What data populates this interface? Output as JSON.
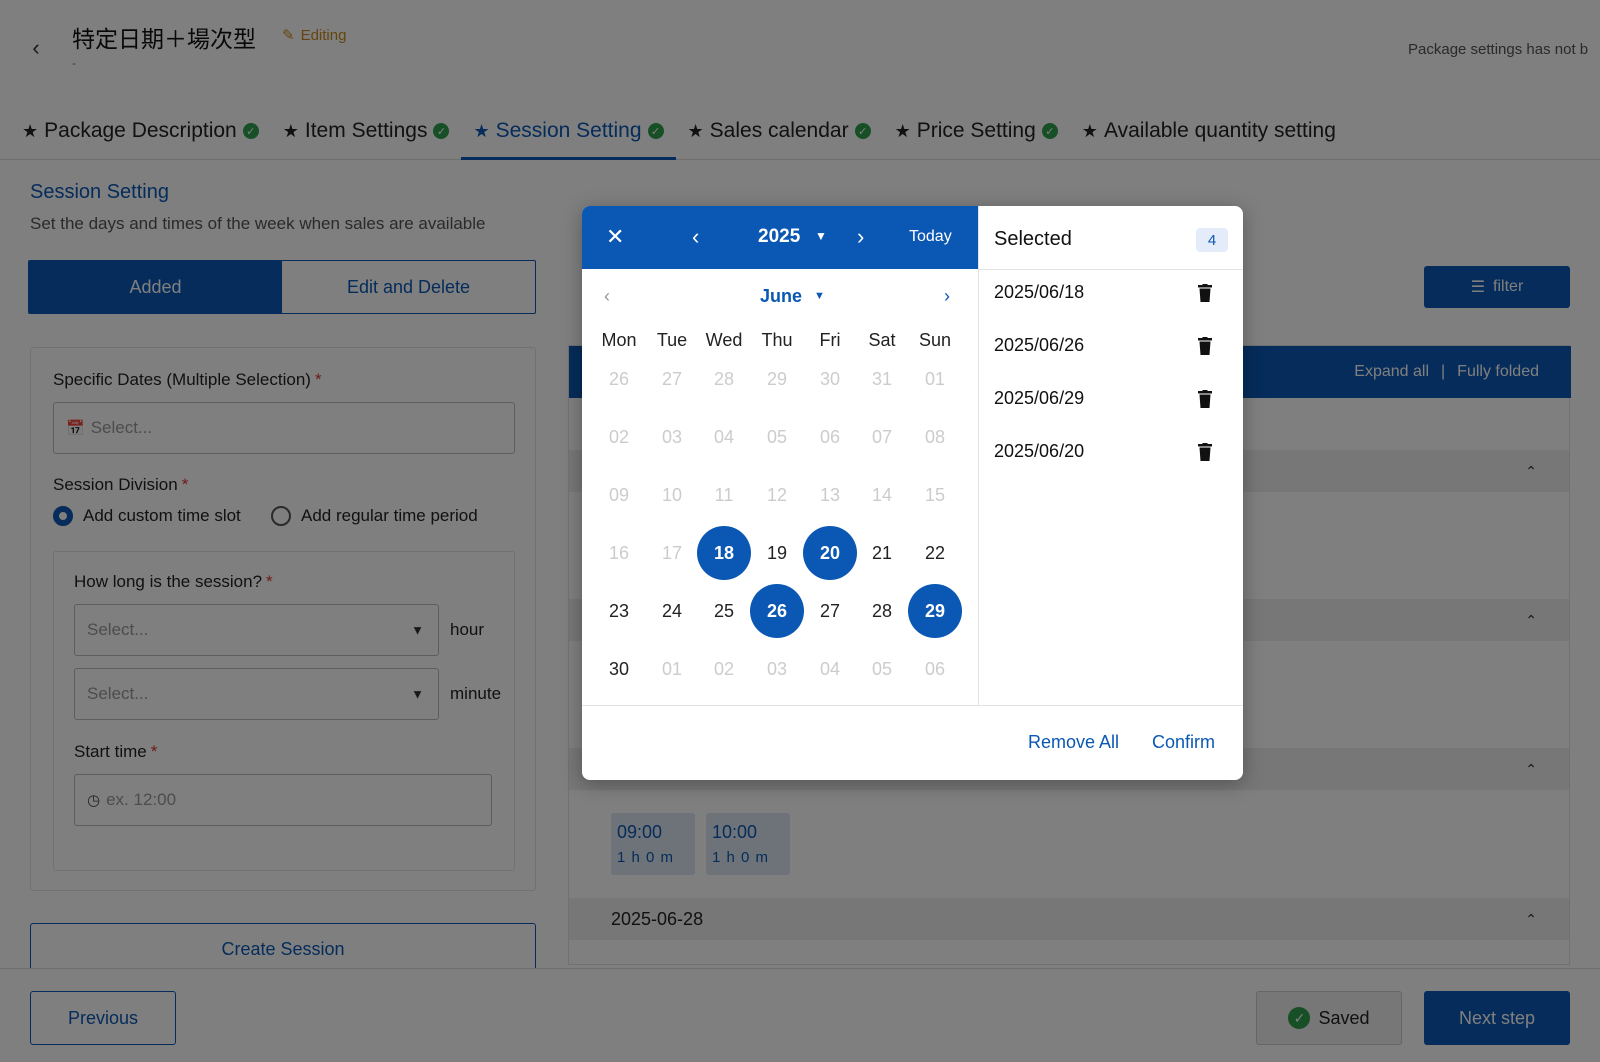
{
  "header": {
    "title": "特定日期＋場次型",
    "editing_label": "Editing",
    "sub_text": "-",
    "notice": "Package settings has not b"
  },
  "tabs": [
    {
      "label": "Package Description",
      "done": true
    },
    {
      "label": "Item Settings",
      "done": true
    },
    {
      "label": "Session Setting",
      "done": true,
      "active": true
    },
    {
      "label": "Sales calendar",
      "done": true
    },
    {
      "label": "Price Setting",
      "done": true
    },
    {
      "label": "Available quantity setting",
      "done": false
    }
  ],
  "section": {
    "title": "Session Setting",
    "description": "Set the days and times of the week when sales are available"
  },
  "segment": {
    "added": "Added",
    "edit_delete": "Edit and Delete"
  },
  "form": {
    "dates_label": "Specific Dates (Multiple Selection)",
    "dates_placeholder": "Select...",
    "division_label": "Session Division",
    "radio_custom": "Add custom time slot",
    "radio_regular": "Add regular time period",
    "duration_label": "How long is the session?",
    "hour_placeholder": "Select...",
    "hour_unit": "hour",
    "minute_placeholder": "Select...",
    "minute_unit": "minute",
    "start_label": "Start time",
    "start_placeholder": "ex. 12:00",
    "required_mark": "*"
  },
  "create_button": "Create Session",
  "filter_button": "filter",
  "list": {
    "expand_all": "Expand all",
    "separator": "|",
    "fully_folded": "Fully folded",
    "slots": [
      {
        "time": "09:00",
        "duration": "1 h 0 m"
      },
      {
        "time": "10:00",
        "duration": "1 h 0 m"
      }
    ],
    "group_date": "2025-06-28"
  },
  "footer": {
    "previous": "Previous",
    "saved": "Saved",
    "next": "Next step"
  },
  "picker": {
    "year": "2025",
    "today": "Today",
    "month": "June",
    "weekdays": [
      "Mon",
      "Tue",
      "Wed",
      "Thu",
      "Fri",
      "Sat",
      "Sun"
    ],
    "weeks": [
      [
        {
          "d": "26",
          "out": true
        },
        {
          "d": "27",
          "out": true
        },
        {
          "d": "28",
          "out": true
        },
        {
          "d": "29",
          "out": true
        },
        {
          "d": "30",
          "out": true
        },
        {
          "d": "31",
          "out": true
        },
        {
          "d": "01",
          "out": true
        }
      ],
      [
        {
          "d": "02",
          "out": true
        },
        {
          "d": "03",
          "out": true
        },
        {
          "d": "04",
          "out": true
        },
        {
          "d": "05",
          "out": true
        },
        {
          "d": "06",
          "out": true
        },
        {
          "d": "07",
          "out": true
        },
        {
          "d": "08",
          "out": true
        }
      ],
      [
        {
          "d": "09",
          "out": true
        },
        {
          "d": "10",
          "out": true
        },
        {
          "d": "11",
          "out": true
        },
        {
          "d": "12",
          "out": true
        },
        {
          "d": "13",
          "out": true
        },
        {
          "d": "14",
          "out": true
        },
        {
          "d": "15",
          "out": true
        }
      ],
      [
        {
          "d": "16",
          "out": true
        },
        {
          "d": "17",
          "out": true
        },
        {
          "d": "18",
          "sel": true
        },
        {
          "d": "19"
        },
        {
          "d": "20",
          "sel": true
        },
        {
          "d": "21"
        },
        {
          "d": "22"
        }
      ],
      [
        {
          "d": "23"
        },
        {
          "d": "24"
        },
        {
          "d": "25"
        },
        {
          "d": "26",
          "sel": true
        },
        {
          "d": "27"
        },
        {
          "d": "28"
        },
        {
          "d": "29",
          "sel": true
        }
      ],
      [
        {
          "d": "30"
        },
        {
          "d": "01",
          "out": true
        },
        {
          "d": "02",
          "out": true
        },
        {
          "d": "03",
          "out": true
        },
        {
          "d": "04",
          "out": true
        },
        {
          "d": "05",
          "out": true
        },
        {
          "d": "06",
          "out": true
        }
      ]
    ],
    "selected_title": "Selected",
    "selected_count": "4",
    "selected_dates": [
      "2025/06/18",
      "2025/06/26",
      "2025/06/29",
      "2025/06/20"
    ],
    "remove_all": "Remove All",
    "confirm": "Confirm"
  },
  "colors": {
    "primary": "#0a58b4",
    "success": "#2e9e4f",
    "editing": "#c98a1b",
    "required": "#d33333"
  }
}
